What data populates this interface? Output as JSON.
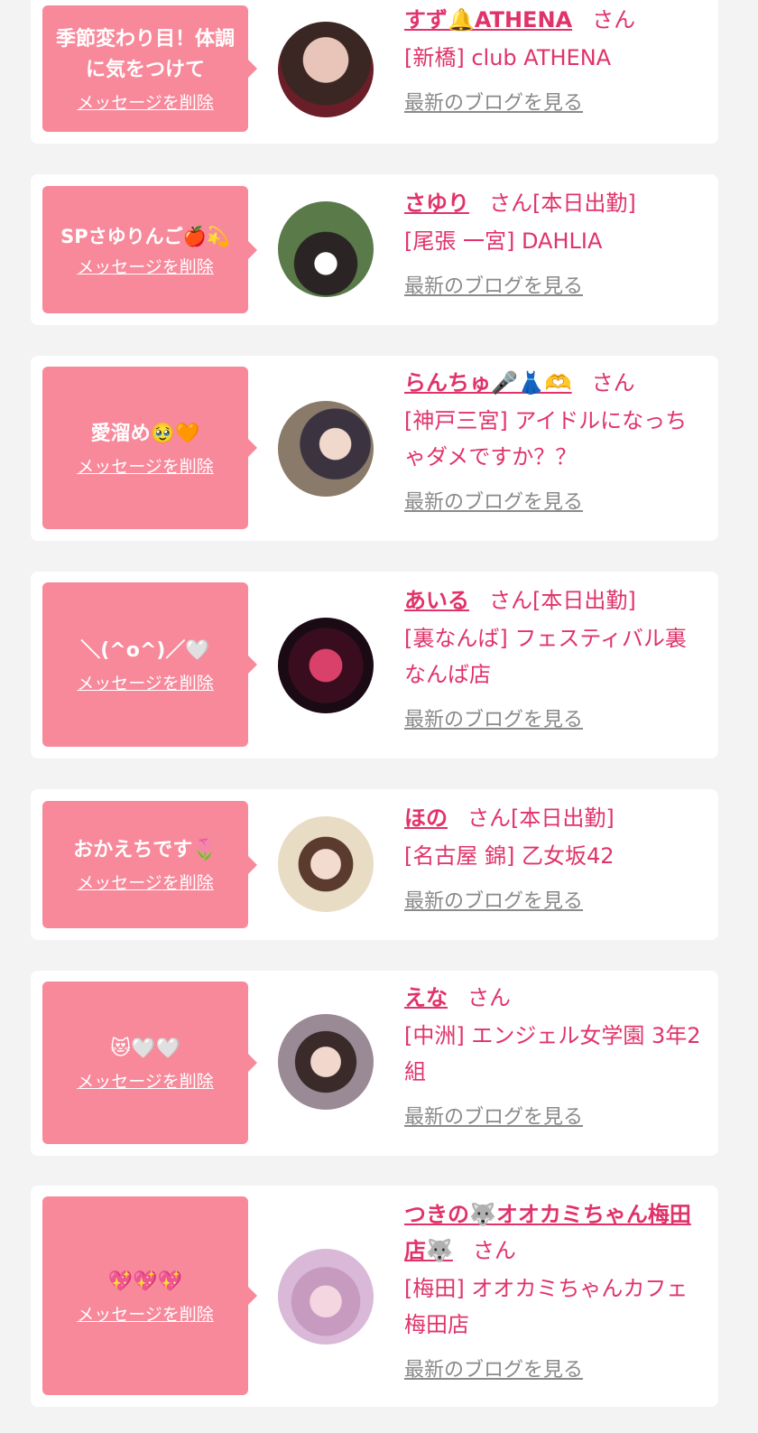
{
  "common": {
    "delete_label": "メッセージを削除",
    "blog_label": "最新のブログを見る",
    "san": "さん",
    "working_today": "[本日出勤]"
  },
  "colors": {
    "background": "#f3f3f3",
    "card": "#ffffff",
    "bubble": "#f7899b",
    "accent": "#e0336a",
    "muted_link": "#8a8a8a"
  },
  "items": [
    {
      "message": "季節変わり目！体調に気をつけて",
      "name": "すず🔔ATHENA",
      "shop": "[新橋] club ATHENA",
      "working": false,
      "avatar": "avatar-suzu"
    },
    {
      "message": "SPさゆりんご🍎💫",
      "name": "さゆり",
      "shop": "[尾張 一宮] DAHLIA",
      "working": true,
      "avatar": "avatar-sayuri"
    },
    {
      "message": "愛溜め🥹🧡",
      "name": "らんちゅ🎤👗🫶",
      "shop": "[神戸三宮] アイドルになっちゃダメですか？？",
      "working": false,
      "avatar": "avatar-ranchu"
    },
    {
      "message": "＼(^o^)／🤍",
      "name": "あいる",
      "shop": "[裏なんば] フェスティバル裏なんば店",
      "working": true,
      "avatar": "avatar-airu"
    },
    {
      "message": "おかえちです🌷",
      "name": "ほの",
      "shop": "[名古屋 錦] 乙女坂42",
      "working": true,
      "avatar": "avatar-hono"
    },
    {
      "message": "😻🤍🤍",
      "name": "えな",
      "shop": "[中洲] エンジェル女学園 3年2組",
      "working": false,
      "avatar": "avatar-ena"
    },
    {
      "message": "💖💖💖",
      "name": "つきの🐺オオカミちゃん梅田店🐺",
      "shop": "[梅田] オオカミちゃんカフェ梅田店",
      "working": false,
      "avatar": "avatar-tsukino"
    }
  ]
}
